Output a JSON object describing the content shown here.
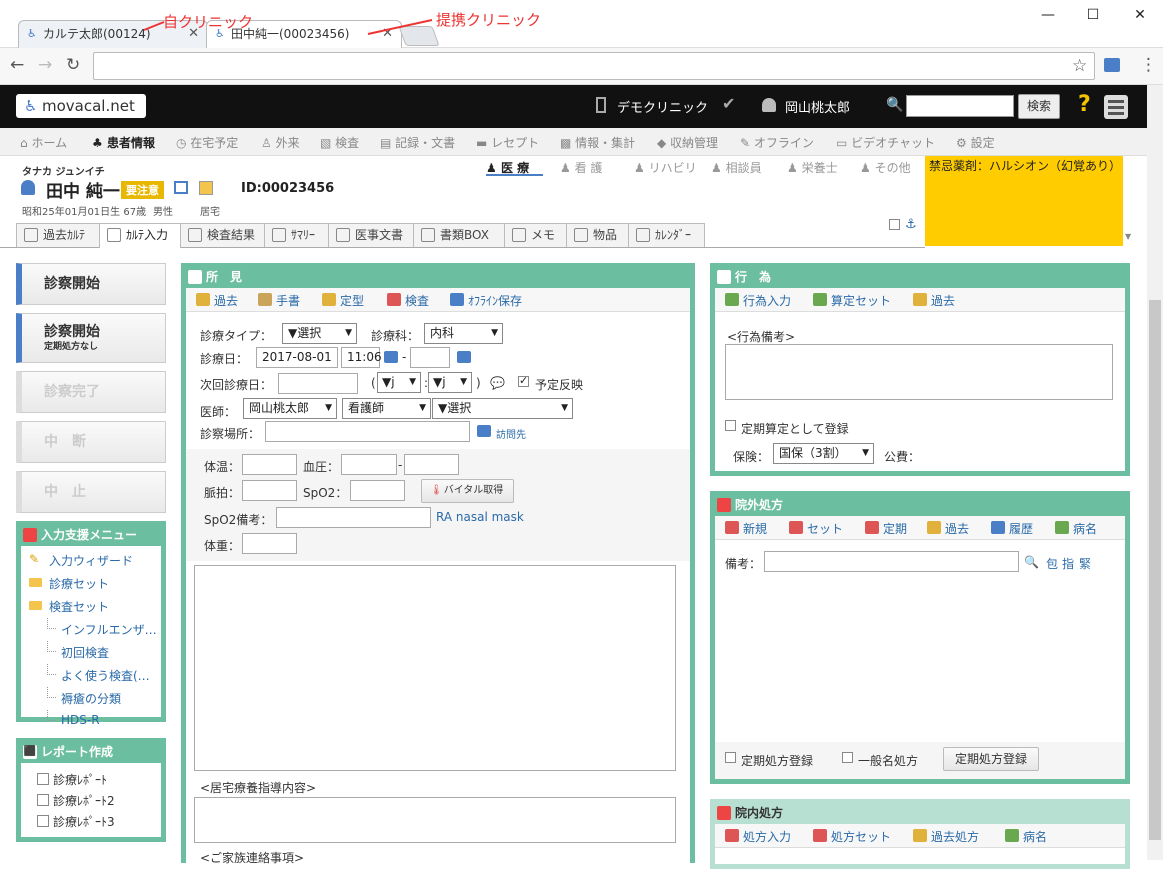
{
  "browser": {
    "tab1": "カルテ太郎(00124)",
    "tab2": "田中純一(00023456)",
    "annot1": "自クリニック",
    "annot2": "提携クリニック",
    "minimize": "—",
    "maximize": "☐",
    "close": "✕",
    "back": "←",
    "forward": "→",
    "reload": "↻",
    "star": "☆",
    "menu": "⋮"
  },
  "header": {
    "logo": "movacal.net",
    "clinic": "デモクリニック",
    "user": "岡山桃太郎",
    "search_btn": "検索",
    "help": "?"
  },
  "menu": [
    "ホーム",
    "患者情報",
    "在宅予定",
    "外来",
    "検査",
    "記録・文書",
    "レセプト",
    "情報・集計",
    "収納管理",
    "オフライン",
    "ビデオチャット",
    "設定"
  ],
  "patient": {
    "kana": "タナカ ジュンイチ",
    "name": "田中 純一",
    "badge": "要注意",
    "id": "ID:00023456",
    "birth": "昭和25年01月01日生 67歳",
    "sex": "男性",
    "home": "居宅"
  },
  "roles": [
    "医 療",
    "看 護",
    "リハビリ",
    "相談員",
    "栄養士",
    "その他"
  ],
  "alert": "禁忌薬剤：ハルシオン（幻覚あり）",
  "subtabs": [
    "過去ｶﾙﾃ",
    "ｶﾙﾃ入力",
    "検査結果",
    "ｻﾏﾘｰ",
    "医事文書",
    "書類BOX",
    "メモ",
    "物品",
    "ｶﾚﾝﾀﾞｰ"
  ],
  "left": {
    "start": "診察開始",
    "start2": "診察開始",
    "start2_sub": "定期処方なし",
    "finish": "診察完了",
    "suspend": "中　断",
    "cancel": "中　止",
    "support_title": "入力支援メニュー",
    "wizard": "入力ウィザード",
    "set": "診療セット",
    "exam_set": "検査セット",
    "exam_items": [
      "インフルエンザ…",
      "初回検査",
      "よく使う検査(…",
      "褥瘡の分類",
      "HDS-R"
    ],
    "report_title": "レポート作成",
    "reports": [
      "診療ﾚﾎﾟｰﾄ",
      "診療ﾚﾎﾟｰﾄ2",
      "診療ﾚﾎﾟｰﾄ3"
    ]
  },
  "findings": {
    "title": "所　見",
    "toolbar": [
      "過去",
      "手書",
      "定型",
      "検査",
      "ｵﾌﾗｲﾝ保存"
    ],
    "type_label": "診療タイプ：",
    "type_val": "▼選択",
    "dept_label": "診療科：",
    "dept_val": "内科",
    "date_label": "診療日：",
    "date": "2017-08-01",
    "time": "11:06",
    "dash": "-",
    "next_label": "次回診療日：",
    "paren_open": "(",
    "paren_close": ")",
    "h": "▼j",
    "m": "▼j",
    "colon": ":",
    "plan": "予定反映",
    "doctor_label": "医師：",
    "doctor": "岡山桃太郎",
    "nurse": "看護師",
    "select": "▼選択",
    "place_label": "診察場所：",
    "visit": "訪問先",
    "temp": "体温：",
    "bp": "血圧：",
    "pulse": "脈拍：",
    "spo2": "SpO2：",
    "vital_btn": "バイタル取得",
    "spo2_note": "SpO2備考：",
    "ra": "RA nasal mask",
    "weight": "体重：",
    "home_label": "<居宅療養指導内容>",
    "family_label": "<ご家族連絡事項>"
  },
  "acts": {
    "title": "行　為",
    "toolbar": [
      "行為入力",
      "算定セット",
      "過去"
    ],
    "note": "<行為備考>",
    "regular": "定期算定として登録",
    "ins_label": "保険：",
    "ins": "国保（3割）",
    "public": "公費："
  },
  "outrx": {
    "title": "院外処方",
    "toolbar": [
      "新規",
      "セット",
      "定期",
      "過去",
      "履歴",
      "病名"
    ],
    "note": "備考：",
    "pkg": "包",
    "inst": "指",
    "urgent": "緊",
    "reg": "定期処方登録",
    "generic": "一般名処方",
    "reg_btn": "定期処方登録"
  },
  "inrx": {
    "title": "院内処方",
    "toolbar": [
      "処方入力",
      "処方セット",
      "過去処方",
      "病名"
    ]
  }
}
